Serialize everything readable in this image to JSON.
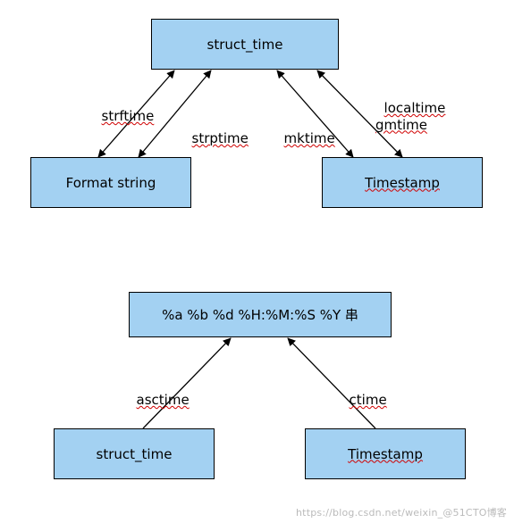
{
  "diagram1": {
    "top_box": "struct_time",
    "left_box": "Format string",
    "right_box": "Timestamp",
    "labels": {
      "strftime": "strftime",
      "strptime": "strptime",
      "mktime": "mktime",
      "localtime_gmtime": "localtime\ngmtime"
    }
  },
  "diagram2": {
    "top_box": "%a %b %d %H:%M:%S %Y 串",
    "left_box": "struct_time",
    "right_box": "Timestamp",
    "labels": {
      "asctime": "asctime",
      "ctime": "ctime"
    }
  },
  "watermark": "https://blog.csdn.net/weixin_@51CTO博客",
  "chart_data": [
    {
      "type": "diagram",
      "title": "Python time module conversions (part 1)",
      "nodes": [
        "struct_time",
        "Format string",
        "Timestamp"
      ],
      "edges": [
        {
          "from": "struct_time",
          "to": "Format string",
          "function": "strftime"
        },
        {
          "from": "Format string",
          "to": "struct_time",
          "function": "strptime"
        },
        {
          "from": "struct_time",
          "to": "Timestamp",
          "function": "mktime"
        },
        {
          "from": "Timestamp",
          "to": "struct_time",
          "function": "localtime"
        },
        {
          "from": "Timestamp",
          "to": "struct_time",
          "function": "gmtime"
        }
      ]
    },
    {
      "type": "diagram",
      "title": "Python time module conversions (part 2)",
      "nodes": [
        "%a %b %d %H:%M:%S %Y 串",
        "struct_time",
        "Timestamp"
      ],
      "edges": [
        {
          "from": "struct_time",
          "to": "%a %b %d %H:%M:%S %Y 串",
          "function": "asctime"
        },
        {
          "from": "Timestamp",
          "to": "%a %b %d %H:%M:%S %Y 串",
          "function": "ctime"
        }
      ]
    }
  ]
}
